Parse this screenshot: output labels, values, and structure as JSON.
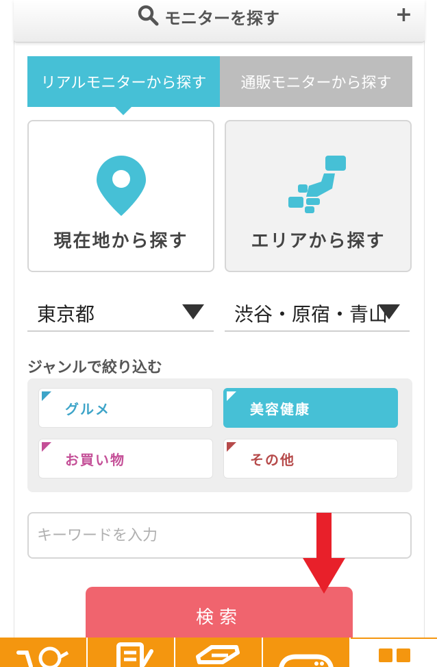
{
  "header": {
    "title": "モニターを探す",
    "icon": "search-icon",
    "expand_icon": "plus-icon"
  },
  "tabs": [
    {
      "label": "リアルモニターから探す",
      "active": true
    },
    {
      "label": "通販モニターから探す",
      "active": false
    }
  ],
  "search_methods": [
    {
      "label": "現在地から探す",
      "icon": "location-pin-icon"
    },
    {
      "label": "エリアから探す",
      "icon": "japan-map-icon"
    }
  ],
  "selects": {
    "prefecture": "東京都",
    "area": "渋谷・原宿・青山"
  },
  "genre": {
    "title": "ジャンルで絞り込む",
    "items": [
      {
        "label": "グルメ",
        "selected": false,
        "color": "#3da4c8"
      },
      {
        "label": "美容健康",
        "selected": true,
        "color": "#46c0d6"
      },
      {
        "label": "お買い物",
        "selected": false,
        "color": "#c44f97"
      },
      {
        "label": "その他",
        "selected": false,
        "color": "#b64a4a"
      }
    ]
  },
  "keyword": {
    "placeholder": "キーワードを入力",
    "value": ""
  },
  "search_button": {
    "label": "検索"
  },
  "colors": {
    "accent": "#46c0d6",
    "button": "#f0646e",
    "nav": "#f4960f",
    "annotation_arrow": "#e8202a"
  },
  "bottom_nav": [
    {
      "icon": "cart-points-icon"
    },
    {
      "icon": "document-edit-icon"
    },
    {
      "icon": "box-icon"
    },
    {
      "icon": "gamepad-icon"
    },
    {
      "icon": "grid-menu-icon",
      "active": true
    }
  ]
}
